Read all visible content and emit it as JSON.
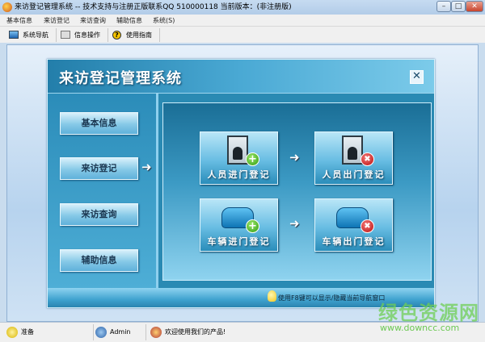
{
  "window": {
    "title": "来访登记管理系统 -- 技术支持与注册正版联系QQ 510000118    当前版本：(非注册版)"
  },
  "menu": [
    "基本信息",
    "来访登记",
    "来访查询",
    "辅助信息",
    "系统(S)"
  ],
  "toolbar": [
    {
      "label": "系统导航",
      "icon": "monitor-icon"
    },
    {
      "label": "信息操作",
      "icon": "grid-icon"
    },
    {
      "label": "使用指南",
      "icon": "help-icon"
    }
  ],
  "panel": {
    "title": "来访登记管理系统",
    "close": "✕",
    "nav": [
      "基本信息",
      "来访登记",
      "来访查询",
      "辅助信息"
    ],
    "active_arrow": "➜",
    "tiles": [
      {
        "label": "人员进门登记",
        "badge": "+"
      },
      {
        "label": "人员出门登记",
        "badge": "✖"
      },
      {
        "label": "车辆进门登记",
        "badge": "+"
      },
      {
        "label": "车辆出门登记",
        "badge": "✖"
      }
    ],
    "hint": "使用F8键可以显示/隐藏当前导航窗口"
  },
  "status": {
    "state": "准备",
    "user": "Admin",
    "message": "欢迎使用我们的产品!"
  },
  "watermark": {
    "name": "绿色资源网",
    "url": "www.downcc.com"
  }
}
